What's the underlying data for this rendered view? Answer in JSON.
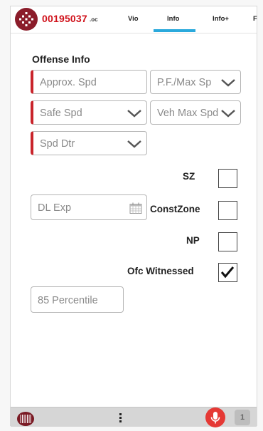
{
  "header": {
    "ticket_number": "00195037",
    "ticket_suffix": ".oc",
    "tabs": [
      {
        "label": "Vio"
      },
      {
        "label": "Info"
      },
      {
        "label": "Info+"
      },
      {
        "label": "F"
      }
    ],
    "active_tab": "Info"
  },
  "section": {
    "title": "Offense Info"
  },
  "fields": {
    "approx_spd": {
      "placeholder": "Approx. Spd"
    },
    "pf_max_sp": {
      "placeholder": "P.F./Max Sp"
    },
    "safe_spd": {
      "placeholder": "Safe Spd"
    },
    "veh_max_spd": {
      "placeholder": "Veh Max Spd"
    },
    "spd_dtr": {
      "placeholder": "Spd Dtr"
    },
    "dl_exp": {
      "placeholder": "DL Exp"
    },
    "percentile_85": {
      "placeholder": "85 Percentile"
    }
  },
  "checkboxes": [
    {
      "label": "SZ",
      "checked": false
    },
    {
      "label": "ConstZone",
      "checked": false
    },
    {
      "label": "NP",
      "checked": false
    },
    {
      "label": "Ofc Witnessed",
      "checked": true
    }
  ],
  "bottombar": {
    "counter": "1"
  },
  "colors": {
    "accent": "#2aa9dc",
    "required": "#c9242b",
    "brand": "#8b1c2a",
    "ticket_red": "#d0121b",
    "mic": "#e53935"
  }
}
